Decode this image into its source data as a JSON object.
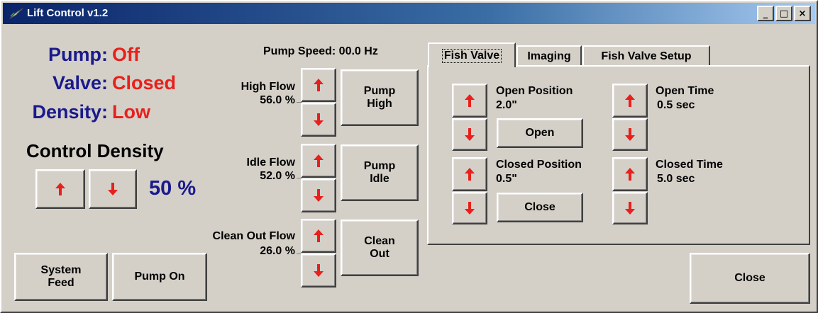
{
  "window": {
    "title": "Lift Control v1.2",
    "controls": [
      "_",
      "□",
      "×"
    ]
  },
  "status": {
    "pump": {
      "label": "Pump:",
      "value": "Off"
    },
    "valve": {
      "label": "Valve:",
      "value": "Closed"
    },
    "density": {
      "label": "Density:",
      "value": "Low"
    }
  },
  "control_density": {
    "heading": "Control Density",
    "percent": "50 %"
  },
  "left_buttons": {
    "system_feed": "System\nFeed",
    "pump_on": "Pump On"
  },
  "pump": {
    "speed_text": "Pump Speed: 00.0 Hz",
    "high_flow": {
      "label": "High Flow",
      "value": "56.0 %",
      "button": "Pump\nHigh"
    },
    "idle_flow": {
      "label": "Idle Flow",
      "value": "52.0 %",
      "button": "Pump\nIdle"
    },
    "clean_out_flow": {
      "label": "Clean Out Flow",
      "value": "26.0 %",
      "button": "Clean\nOut"
    }
  },
  "tabs": [
    "Fish Valve",
    "Imaging",
    "Fish Valve Setup"
  ],
  "fish_valve": {
    "open_position": {
      "label": "Open Position",
      "value": "2.0\""
    },
    "open_button": "Open",
    "closed_position": {
      "label": "Closed Position",
      "value": "0.5\""
    },
    "close_button": "Close",
    "open_time": {
      "label": "Open Time",
      "value": "0.5 sec"
    },
    "closed_time": {
      "label": "Closed Time",
      "value": "5.0 sec"
    }
  },
  "close_button": "Close",
  "colors": {
    "status_label": "#1a1a8c",
    "status_value": "#e8201c",
    "arrow": "#e8201c"
  },
  "icons": {
    "arrow_up": "arrow-up-icon",
    "arrow_down": "arrow-down-icon",
    "app": "lightning-icon"
  }
}
